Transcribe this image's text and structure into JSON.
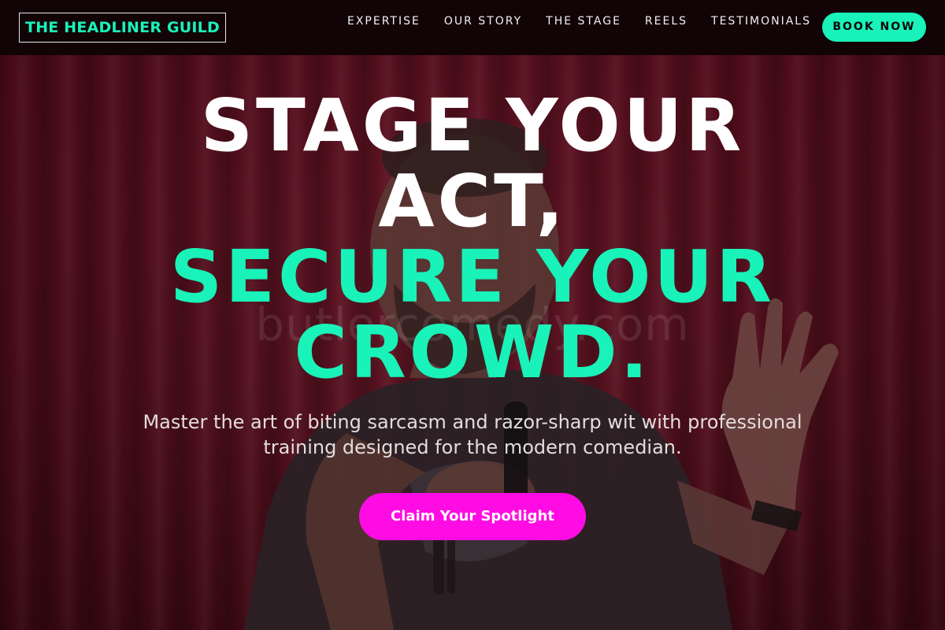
{
  "navbar": {
    "brand": "THE HEADLINER GUILD",
    "links": [
      {
        "label": "EXPERTISE"
      },
      {
        "label": "OUR STORY"
      },
      {
        "label": "THE STAGE"
      },
      {
        "label": "REELS"
      },
      {
        "label": "TESTIMONIALS"
      }
    ],
    "book_label": "BOOK NOW"
  },
  "hero": {
    "headline_line1": "STAGE YOUR",
    "headline_line2": "ACT,",
    "headline_line3": "SECURE YOUR",
    "headline_line4": "CROWD.",
    "subtitle": "Master the art of biting sarcasm and razor-sharp wit with professional training designed for the modern comedian.",
    "cta_label": "Claim Your Spotlight",
    "watermark": "butlercomedy.com"
  },
  "colors": {
    "accent_teal": "#19f2b9",
    "accent_magenta": "#ff0ce4",
    "navbar_bg": "#120307",
    "curtain_red": "#6e0f22"
  },
  "icons": {
    "performer_image": "comedian-performing-photo"
  }
}
